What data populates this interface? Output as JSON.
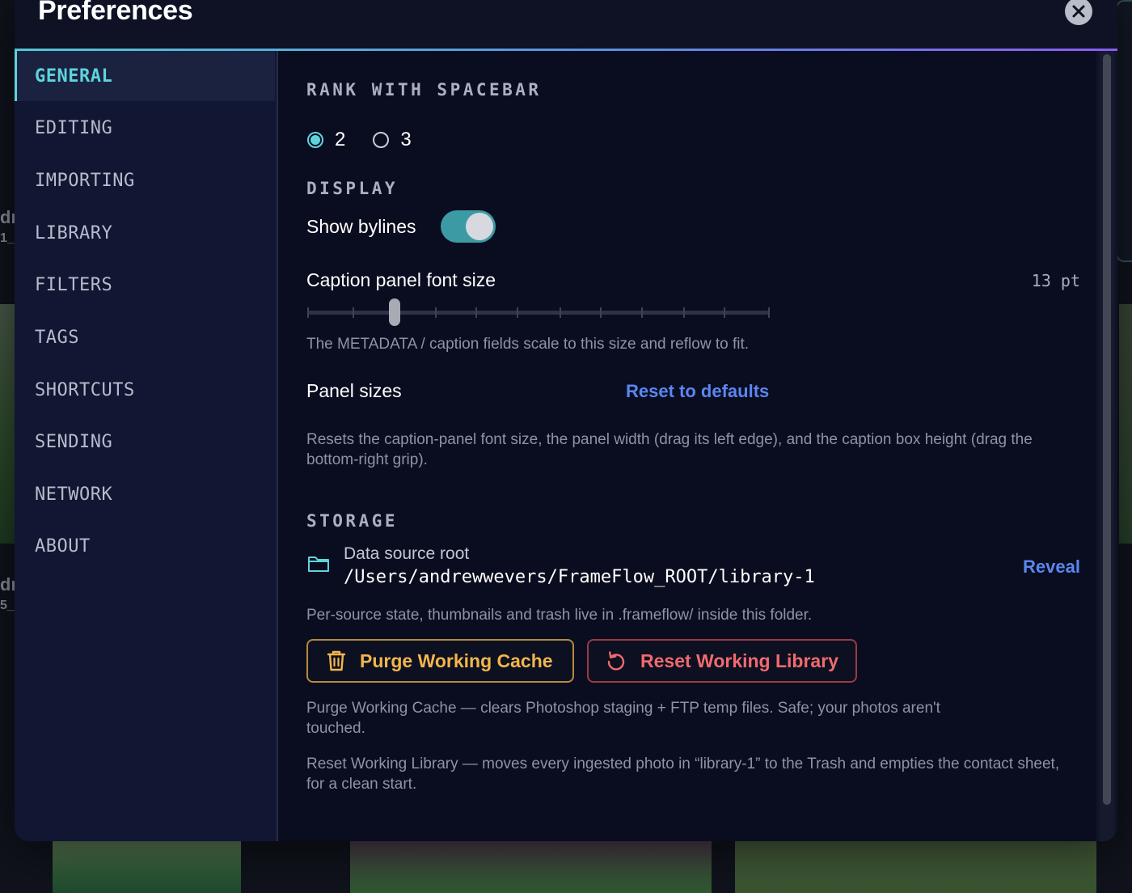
{
  "background": {
    "fragment_top": "dr",
    "fragment_top_sub": "1_",
    "fragment_bottom": "dr",
    "fragment_bottom_sub": "5_"
  },
  "dialog": {
    "title": "Preferences",
    "close_icon": "close-icon"
  },
  "sidebar": {
    "items": [
      {
        "label": "GENERAL",
        "active": true
      },
      {
        "label": "EDITING"
      },
      {
        "label": "IMPORTING"
      },
      {
        "label": "LIBRARY"
      },
      {
        "label": "FILTERS"
      },
      {
        "label": "TAGS"
      },
      {
        "label": "SHORTCUTS"
      },
      {
        "label": "SENDING"
      },
      {
        "label": "NETWORK"
      },
      {
        "label": "ABOUT"
      }
    ]
  },
  "general": {
    "rank": {
      "heading": "RANK WITH SPACEBAR",
      "options": [
        "2",
        "3"
      ],
      "selected": "2"
    },
    "display": {
      "heading": "DISPLAY",
      "bylines_label": "Show bylines",
      "bylines_on": true,
      "font_size_label": "Caption panel font size",
      "font_size_value": "13 pt",
      "font_size_slider": {
        "min_step": 0,
        "max_step": 11,
        "step": 2
      },
      "font_size_help": "The METADATA / caption fields scale to this size and reflow to fit.",
      "panel_sizes_label": "Panel sizes",
      "reset_defaults_label": "Reset to defaults",
      "panel_sizes_help": "Resets the caption-panel font size, the panel width (drag its left edge), and the caption box height (drag the bottom-right grip)."
    },
    "storage": {
      "heading": "STORAGE",
      "source_label": "Data source root",
      "source_path": "/Users/andrewwevers/FrameFlow_ROOT/library-1",
      "reveal_label": "Reveal",
      "source_help": "Per-source state, thumbnails and trash live in .frameflow/ inside this folder.",
      "purge_label": "Purge Working Cache",
      "reset_label": "Reset Working Library",
      "purge_help": "Purge Working Cache — clears Photoshop staging + FTP temp files. Safe; your photos aren't touched.",
      "reset_help": "Reset Working Library — moves every ingested photo in “library-1” to the Trash and empties the contact sheet, for a clean start."
    }
  },
  "colors": {
    "accent": "#5fd3dc",
    "link": "#5b86f0",
    "warning": "#f3b64c",
    "danger": "#f06a6f"
  }
}
